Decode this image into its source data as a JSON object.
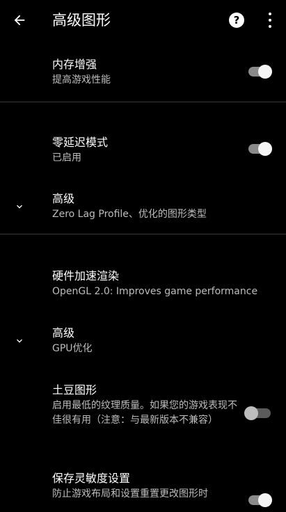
{
  "appbar": {
    "title": "高级图形",
    "help_glyph": "?",
    "icons": {
      "back": "arrow-left-icon",
      "help": "help-circle-icon",
      "more": "more-vert-icon"
    }
  },
  "colors": {
    "background": "#000000",
    "divider": "#3a3a3a",
    "text_primary": "#ffffff",
    "text_secondary": "#bdbdbd",
    "switch_on_track": "#8a8a8a",
    "switch_on_thumb": "#f5f5f5",
    "switch_off_track": "#5b5b5b",
    "switch_off_thumb": "#bdbdbd"
  },
  "settings": {
    "memory_boost": {
      "title": "内存增强",
      "summary": "提高游戏性能",
      "enabled": true
    },
    "zero_lag": {
      "title": "零延迟模式",
      "summary": "已启用",
      "enabled": true
    },
    "advanced_zero_lag": {
      "title": "高级",
      "summary": "Zero Lag Profile、优化的图形类型"
    },
    "hw_render": {
      "title": "硬件加速渲染",
      "summary": "OpenGL 2.0: Improves game performance"
    },
    "advanced_gpu": {
      "title": "高级",
      "summary": "GPU优化"
    },
    "potato_graphics": {
      "title": "土豆图形",
      "summary": "启用最低的纹理质量。如果您的游戏表现不佳很有用（注意：与最新版本不兼容）",
      "enabled": false
    },
    "save_sensitivity": {
      "title": "保存灵敏度设置",
      "summary": "防止游戏布局和设置重置更改图形时",
      "enabled": true
    }
  }
}
